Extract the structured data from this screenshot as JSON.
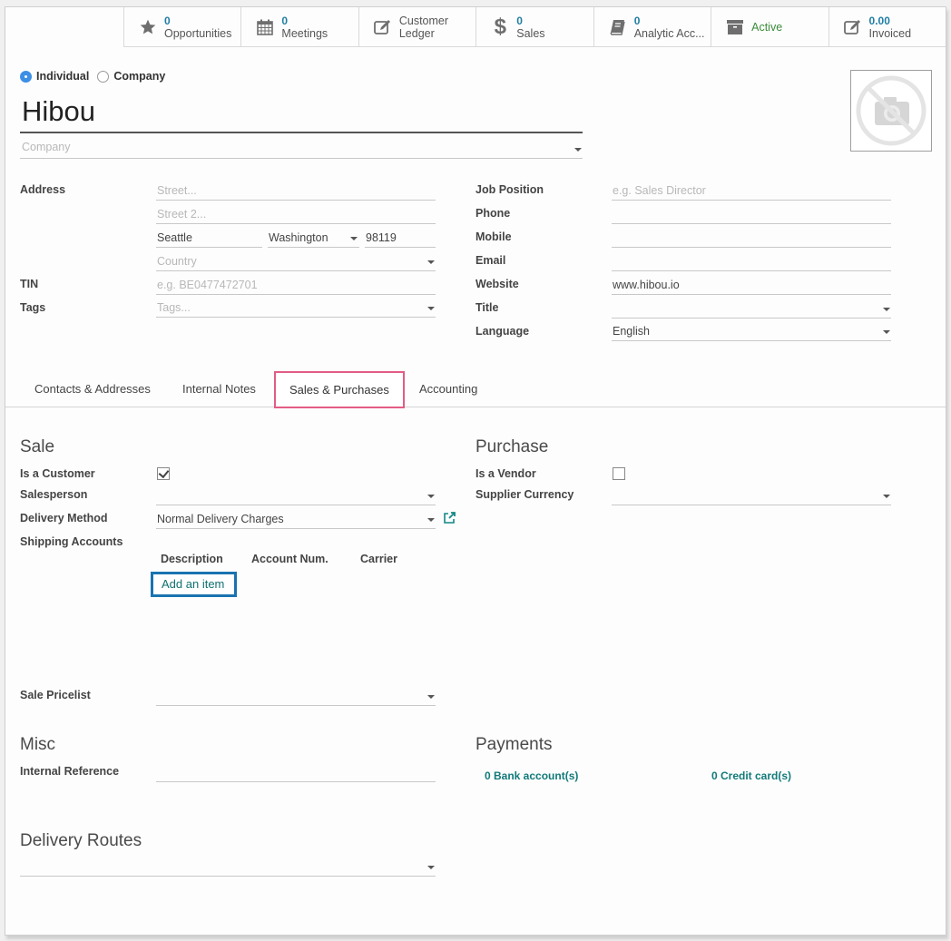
{
  "button_box": [
    {
      "icon": "star-icon",
      "value": "0",
      "label": "Opportunities"
    },
    {
      "icon": "calendar-icon",
      "value": "0",
      "label": "Meetings"
    },
    {
      "icon": "edit-icon",
      "value": "",
      "label": "Customer",
      "label2": "Ledger"
    },
    {
      "icon": "dollar-icon",
      "value": "0",
      "label": "Sales"
    },
    {
      "icon": "book-icon",
      "value": "0",
      "label": "Analytic Acc..."
    },
    {
      "icon": "archive-icon",
      "value": "",
      "label": "Active"
    },
    {
      "icon": "edit-icon",
      "value": "0.00",
      "label": "Invoiced"
    }
  ],
  "partner_type": {
    "options": [
      "Individual",
      "Company"
    ],
    "selected": "Individual"
  },
  "partner": {
    "name": "Hibou",
    "company_placeholder": "Company"
  },
  "address": {
    "label": "Address",
    "street_placeholder": "Street...",
    "street2_placeholder": "Street 2...",
    "city": "Seattle",
    "state": "Washington",
    "zip": "98119",
    "country_placeholder": "Country"
  },
  "tin": {
    "label": "TIN",
    "placeholder": "e.g. BE0477472701"
  },
  "tags": {
    "label": "Tags",
    "placeholder": "Tags..."
  },
  "right_fields": {
    "job_position": {
      "label": "Job Position",
      "placeholder": "e.g. Sales Director"
    },
    "phone": {
      "label": "Phone",
      "value": ""
    },
    "mobile": {
      "label": "Mobile",
      "value": ""
    },
    "email": {
      "label": "Email",
      "value": ""
    },
    "website": {
      "label": "Website",
      "value": "www.hibou.io"
    },
    "title": {
      "label": "Title",
      "value": ""
    },
    "language": {
      "label": "Language",
      "value": "English"
    }
  },
  "tabs": [
    {
      "label": "Contacts & Addresses",
      "active": false
    },
    {
      "label": "Internal Notes",
      "active": false
    },
    {
      "label": "Sales & Purchases",
      "active": true
    },
    {
      "label": "Accounting",
      "active": false
    }
  ],
  "sale": {
    "title": "Sale",
    "is_customer": {
      "label": "Is a Customer",
      "checked": true
    },
    "salesperson": {
      "label": "Salesperson",
      "value": ""
    },
    "delivery_method": {
      "label": "Delivery Method",
      "value": "Normal Delivery Charges"
    },
    "shipping_accounts": {
      "label": "Shipping Accounts",
      "columns": [
        "Description",
        "Account Num.",
        "Carrier"
      ],
      "add_item_label": "Add an item"
    },
    "pricelist": {
      "label": "Sale Pricelist",
      "value": ""
    }
  },
  "purchase": {
    "title": "Purchase",
    "is_vendor": {
      "label": "Is a Vendor",
      "checked": false
    },
    "supplier_currency": {
      "label": "Supplier Currency",
      "value": ""
    }
  },
  "misc": {
    "title": "Misc",
    "internal_reference": {
      "label": "Internal Reference",
      "value": ""
    }
  },
  "payments": {
    "title": "Payments",
    "bank_accounts": "0 Bank account(s)",
    "credit_cards": "0 Credit card(s)"
  },
  "delivery_routes": {
    "title": "Delivery Routes",
    "value": ""
  },
  "colors": {
    "stat_value": "#1f7ea4",
    "active_status": "#3b8b3b",
    "link": "#127a7a",
    "active_tab_border": "#e25d85",
    "add_item_border": "#1a73b0",
    "radio_selected": "#3d8fe6"
  }
}
